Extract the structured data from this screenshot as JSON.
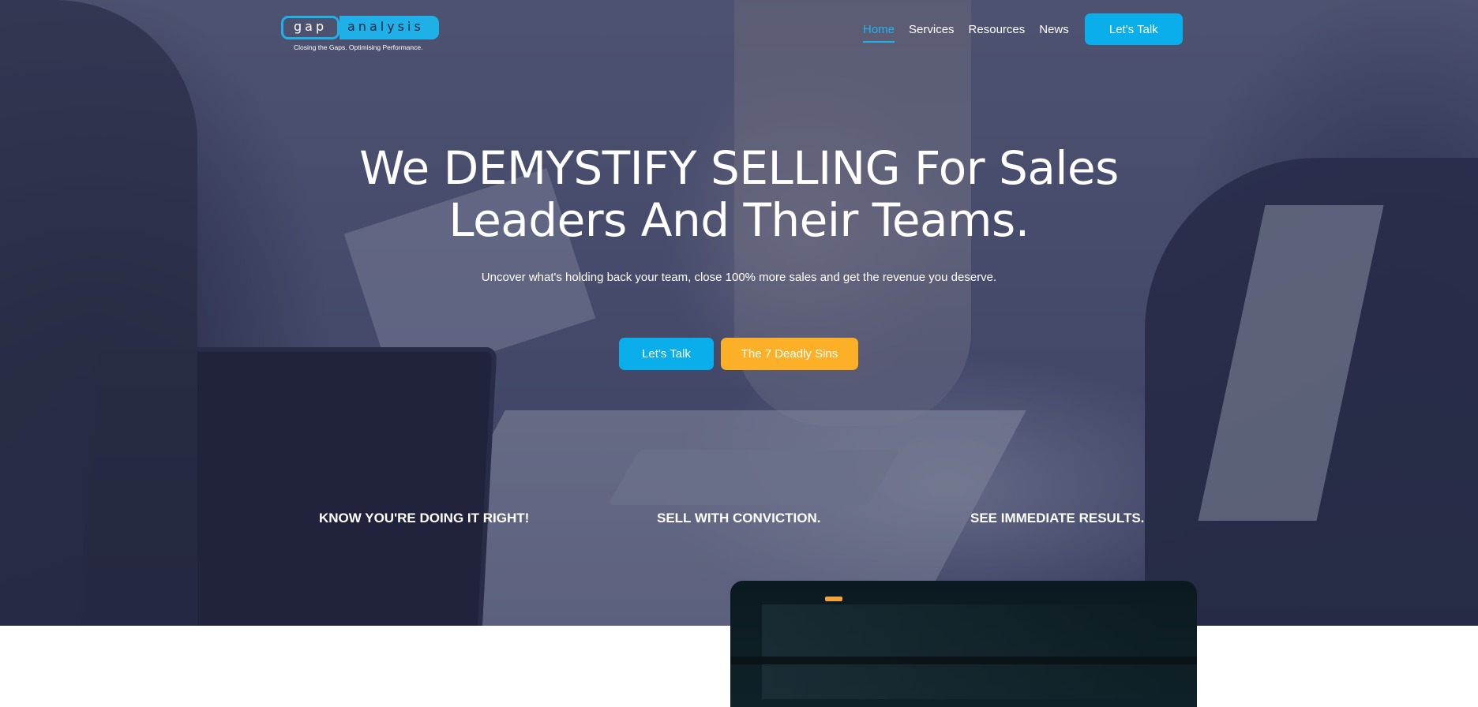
{
  "logo": {
    "word_gap": "gap",
    "word_analysis": "analysis",
    "tagline": "Closing the Gaps. Optimising Performance."
  },
  "nav": {
    "items": [
      {
        "label": "Home",
        "active": true
      },
      {
        "label": "Services",
        "active": false
      },
      {
        "label": "Resources",
        "active": false
      },
      {
        "label": "News",
        "active": false
      }
    ],
    "cta_label": "Let's Talk"
  },
  "hero": {
    "headline_line1": "We DEMYSTIFY SELLING For Sales",
    "headline_line2": "Leaders And Their Teams.",
    "subheadline": "Uncover what's holding back your team, close 100% more sales and get the revenue you deserve.",
    "primary_button": "Let's Talk",
    "secondary_button": "The 7 Deadly Sins"
  },
  "features": [
    "KNOW YOU'RE DOING IT RIGHT!",
    "SELL WITH CONVICTION.",
    "SEE IMMEDIATE RESULTS."
  ],
  "colors": {
    "accent_blue": "#09aeea",
    "accent_orange": "#fcb028",
    "active_nav": "#22b3ee"
  }
}
